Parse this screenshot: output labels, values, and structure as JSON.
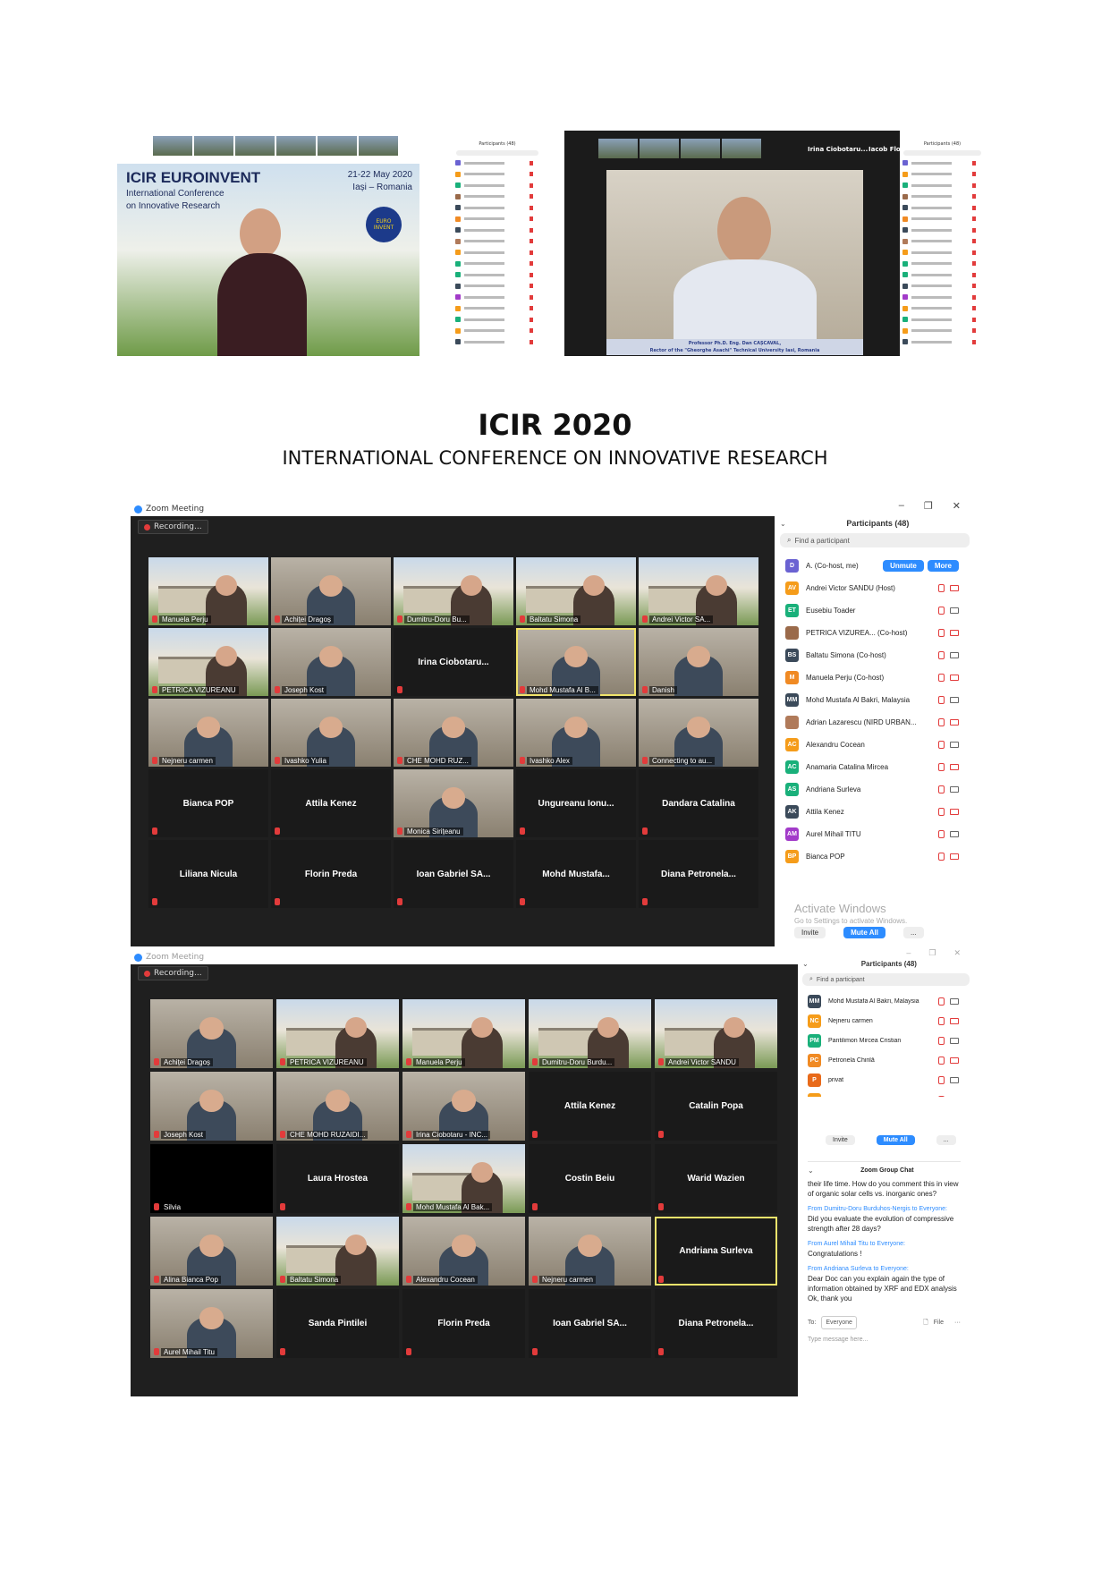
{
  "heading": {
    "title": "ICIR 2020",
    "subtitle": "INTERNATIONAL CONFERENCE ON INNOVATIVE RESEARCH"
  },
  "top_left": {
    "slide_title": "ICIR EUROINVENT",
    "slide_line1": "International Conference",
    "slide_line2": "on Innovative Research",
    "slide_date": "21-22 May 2020",
    "slide_place": "Iași – Romania",
    "logo_text": "EURO INVENT",
    "panel_title": "Participants (48)"
  },
  "top_right": {
    "strip_name1": "Irina Ciobotaru...",
    "strip_name2": "Iacob Florin",
    "caption_line1": "Professor Ph.D. Eng. Dan CAȘCAVAL,",
    "caption_line2": "Rector of the \"Gheorghe Asachi\" Technical University Iasi, Romania",
    "panel_title": "Participants (48)"
  },
  "middle": {
    "window_title": "Zoom Meeting",
    "recording": "Recording...",
    "tiles": [
      {
        "name": "Manuela Perju",
        "kind": "photo"
      },
      {
        "name": "Achiței Dragoș",
        "kind": "room"
      },
      {
        "name": "Dumitru-Doru Bu...",
        "kind": "photo"
      },
      {
        "name": "Baltatu Simona",
        "kind": "photo"
      },
      {
        "name": "Andrei Victor SA...",
        "kind": "photo"
      },
      {
        "name": "PETRICA VIZUREANU",
        "kind": "photo"
      },
      {
        "name": "Joseph Kost",
        "kind": "room"
      },
      {
        "name": "Irina  Ciobotaru...",
        "kind": "name"
      },
      {
        "name": "Mohd Mustafa Al B...",
        "kind": "room",
        "active": true
      },
      {
        "name": "Danish",
        "kind": "room"
      },
      {
        "name": "Nejneru carmen",
        "kind": "room"
      },
      {
        "name": "Ivashko Yulia",
        "kind": "room"
      },
      {
        "name": "CHE MOHD RUZ...",
        "kind": "room"
      },
      {
        "name": "Ivashko Alex",
        "kind": "room"
      },
      {
        "name": "Connecting to au...",
        "kind": "room"
      },
      {
        "name": "Bianca POP",
        "kind": "name"
      },
      {
        "name": "Attila Kenez",
        "kind": "name"
      },
      {
        "name": "Monica Sirițeanu",
        "kind": "room"
      },
      {
        "name": "Ungureanu  Ionu...",
        "kind": "name"
      },
      {
        "name": "Dandara Catalina",
        "kind": "name"
      },
      {
        "name": "Liliana Nicula",
        "kind": "name"
      },
      {
        "name": "Florin Preda",
        "kind": "name"
      },
      {
        "name": "Ioan Gabriel SA...",
        "kind": "name"
      },
      {
        "name": "Mohd  Mustafa...",
        "kind": "name"
      },
      {
        "name": "Diana  Petronela...",
        "kind": "name"
      }
    ],
    "panel": {
      "title": "Participants (48)",
      "search_placeholder": "Find a participant",
      "unmute": "Unmute",
      "more": "More",
      "rows": [
        {
          "initials": "D",
          "name": "A. (Co-host, me)",
          "color": "#6a62d2"
        },
        {
          "initials": "AV",
          "name": "Andrei Victor SANDU (Host)",
          "color": "#f59c1a"
        },
        {
          "initials": "ET",
          "name": "Eusebiu Toader",
          "color": "#19b07a"
        },
        {
          "initials": "",
          "name": "PETRICA VIZUREA... (Co-host)",
          "color": "#9a6a4a"
        },
        {
          "initials": "BS",
          "name": "Baltatu Simona (Co-host)",
          "color": "#3b4a5a"
        },
        {
          "initials": "M",
          "name": "Manuela Perju (Co-host)",
          "color": "#f08a24"
        },
        {
          "initials": "MM",
          "name": "Mohd Mustafa Al Bakri, Malaysia",
          "color": "#3b4a5a"
        },
        {
          "initials": "",
          "name": "Adrian Lazarescu (NIRD URBAN...",
          "color": "#b07a5a"
        },
        {
          "initials": "AC",
          "name": "Alexandru Cocean",
          "color": "#f59c1a"
        },
        {
          "initials": "AC",
          "name": "Anamaria Catalina Mircea",
          "color": "#19b07a"
        },
        {
          "initials": "AS",
          "name": "Andriana Surleva",
          "color": "#19b07a"
        },
        {
          "initials": "AK",
          "name": "Attila Kenez",
          "color": "#3b4a5a"
        },
        {
          "initials": "AM",
          "name": "Aurel Mihail TITU",
          "color": "#a23bc9"
        },
        {
          "initials": "BP",
          "name": "Bianca POP",
          "color": "#f59c1a"
        }
      ],
      "watermark1": "Activate Windows",
      "watermark2": "Go to Settings to activate Windows.",
      "invite": "Invite",
      "mute_all": "Mute All"
    }
  },
  "bottom": {
    "window_title": "Zoom Meeting",
    "recording": "Recording...",
    "tiles": [
      {
        "name": "Achiței Dragoș",
        "kind": "room"
      },
      {
        "name": "PETRICA VIZUREANU",
        "kind": "photo"
      },
      {
        "name": "Manuela Perju",
        "kind": "photo"
      },
      {
        "name": "Dumitru-Doru Burdu...",
        "kind": "photo"
      },
      {
        "name": "Andrei Victor SANDU",
        "kind": "photo"
      },
      {
        "name": "Joseph Kost",
        "kind": "room"
      },
      {
        "name": "CHE MOHD RUZAIDI...",
        "kind": "room"
      },
      {
        "name": "Irina Ciobotaru - INC...",
        "kind": "room"
      },
      {
        "name": "Attila Kenez",
        "kind": "name"
      },
      {
        "name": "Catalin Popa",
        "kind": "name"
      },
      {
        "name": "Silvia",
        "kind": "dark"
      },
      {
        "name": "Laura Hrostea",
        "kind": "name"
      },
      {
        "name": "Mohd Mustafa Al Bak...",
        "kind": "photo"
      },
      {
        "name": "Costin Beiu",
        "kind": "name"
      },
      {
        "name": "Warid Wazien",
        "kind": "name"
      },
      {
        "name": "Alina Bianca Pop",
        "kind": "room"
      },
      {
        "name": "Baltatu Simona",
        "kind": "photo"
      },
      {
        "name": "Alexandru Cocean",
        "kind": "room"
      },
      {
        "name": "Nejneru carmen",
        "kind": "room"
      },
      {
        "name": "Andriana Surleva",
        "kind": "name",
        "active": true
      },
      {
        "name": "Aurel Mihail Titu",
        "kind": "room"
      },
      {
        "name": "Sanda Pintilei",
        "kind": "name"
      },
      {
        "name": "Florin Preda",
        "kind": "name"
      },
      {
        "name": "Ioan Gabriel SA...",
        "kind": "name"
      },
      {
        "name": "Diana  Petronela...",
        "kind": "name"
      }
    ],
    "panel": {
      "title": "Participants (48)",
      "search_placeholder": "Find a participant",
      "rows": [
        {
          "initials": "MM",
          "name": "Mohd Mustafa Al Bakri, Malaysia",
          "color": "#3b4a5a"
        },
        {
          "initials": "NC",
          "name": "Nejneru carmen",
          "color": "#f59c1a"
        },
        {
          "initials": "PM",
          "name": "Pantilimon Mircea Cristian",
          "color": "#19b07a"
        },
        {
          "initials": "PC",
          "name": "Petronela Chirilă",
          "color": "#f08a24"
        },
        {
          "initials": "P",
          "name": "privat",
          "color": "#e86a1a"
        },
        {
          "initials": "SP",
          "name": "Sanda Pintilei",
          "color": "#f59c1a"
        }
      ],
      "invite": "Invite",
      "mute_all": "Mute All"
    },
    "chat": {
      "title": "Zoom Group Chat",
      "msg0": "their life time. How do you comment this in view of organic solar cells vs. inorganic ones?",
      "from1": "From Dumitru-Doru Burduhos-Nergis to Everyone:",
      "msg1": "Did you evaluate the evolution of compressive strength after 28 days?",
      "from2": "From Aurel Mihail Titu to Everyone:",
      "msg2": "Congratulations !",
      "from3": "From Andriana Surleva to Everyone:",
      "msg3": "Dear Doc can you explain again the type of information obtained by XRF and EDX analysis",
      "msg4": "Ok, thank you",
      "to_label": "To:",
      "to_value": "Everyone",
      "file_label": "File",
      "input_placeholder": "Type message here..."
    }
  }
}
